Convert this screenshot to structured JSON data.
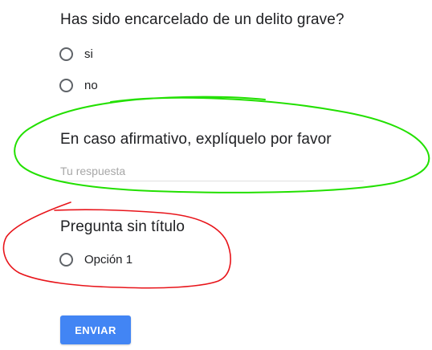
{
  "colors": {
    "accent": "#4285f4",
    "green_annotation": "#22e000",
    "red_annotation": "#e8141a"
  },
  "questions": [
    {
      "title": "Has sido encarcelado de un delito grave?",
      "options": [
        "si",
        "no"
      ]
    },
    {
      "title": "En caso afirmativo, explíquelo por favor",
      "answer_placeholder": "Tu respuesta",
      "answer_value": ""
    },
    {
      "title": "Pregunta sin título",
      "options": [
        "Opción 1"
      ]
    }
  ],
  "submit": {
    "label": "ENVIAR"
  }
}
